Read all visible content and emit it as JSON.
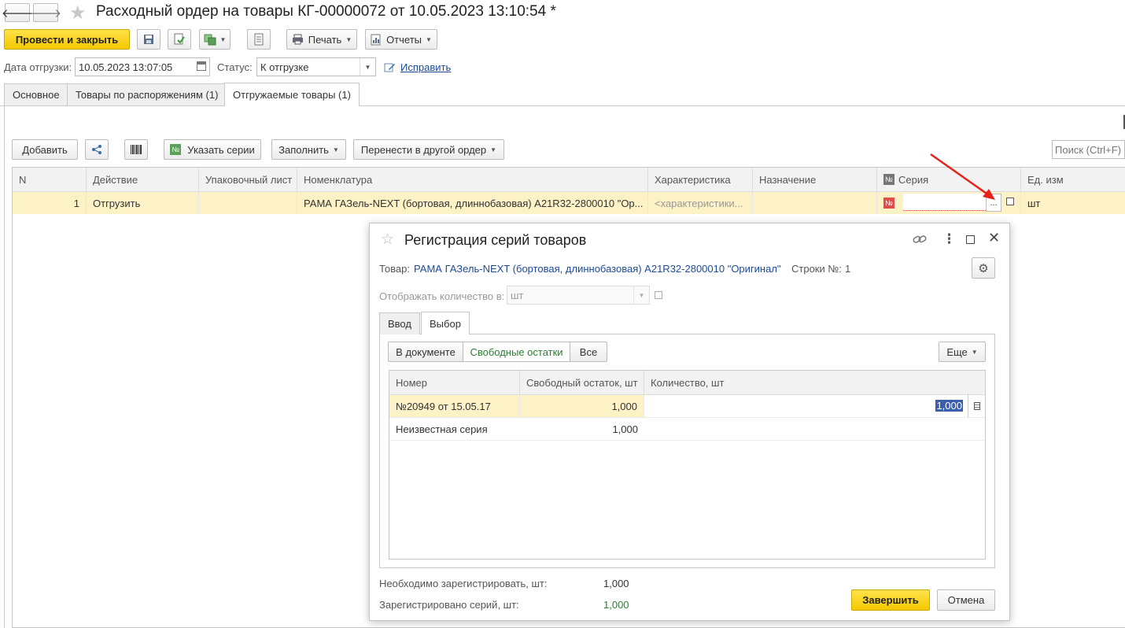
{
  "window": {
    "title": "Расходный ордер на товары КГ-00000072 от 10.05.2023 13:10:54 *"
  },
  "toolbar": {
    "post_close": "Провести и закрыть",
    "print": "Печать",
    "reports": "Отчеты"
  },
  "form": {
    "ship_date_label": "Дата отгрузки:",
    "ship_date_value": "10.05.2023 13:07:05",
    "status_label": "Статус:",
    "status_value": "К отгрузке",
    "fix_link": "Исправить"
  },
  "tabs": [
    {
      "label": "Основное"
    },
    {
      "label": "Товары по распоряжениям (1)"
    },
    {
      "label": "Отгружаемые товары (1)"
    }
  ],
  "table_toolbar": {
    "add": "Добавить",
    "specify_series": "Указать серии",
    "fill": "Заполнить",
    "move_to_order": "Перенести в другой ордер",
    "search_placeholder": "Поиск (Ctrl+F)"
  },
  "table": {
    "columns": [
      "N",
      "Действие",
      "Упаковочный лист",
      "Номенклатура",
      "Характеристика",
      "Назначение",
      "Серия",
      "Ед. изм"
    ],
    "rows": [
      {
        "n": "1",
        "action": "Отгрузить",
        "packing_list": "",
        "nomenclature": "РАМА ГАЗель-NEXT (бортовая, длиннобазовая) А21R32-2800010 \"Ор...",
        "characteristic": "<характеристики...",
        "purpose": "",
        "series": "",
        "series_button": "...",
        "unit": "шт"
      }
    ]
  },
  "dialog": {
    "title": "Регистрация серий товаров",
    "product_label": "Товар:",
    "product_value": "РАМА ГАЗель-NEXT (бортовая, длиннобазовая) А21R32-2800010 \"Оригинал\"",
    "rows_label": "Строки №:",
    "rows_value": "1",
    "show_qty_label": "Отображать количество в:",
    "show_qty_value": "шт",
    "tabs": [
      {
        "label": "Ввод"
      },
      {
        "label": "Выбор"
      }
    ],
    "filter_buttons": [
      {
        "label": "В документе"
      },
      {
        "label": "Свободные остатки"
      },
      {
        "label": "Все"
      }
    ],
    "more_button": "Еще",
    "grid": {
      "columns": [
        "Номер",
        "Свободный остаток, шт",
        "Количество, шт"
      ],
      "rows": [
        {
          "number": "№20949 от 15.05.17",
          "free": "1,000",
          "qty": "1,000"
        },
        {
          "number": "Неизвестная серия",
          "free": "1,000",
          "qty": ""
        }
      ]
    },
    "need_register_label": "Необходимо зарегистрировать, шт:",
    "need_register_value": "1,000",
    "registered_label": "Зарегистрировано серий, шт:",
    "registered_value": "1,000",
    "finish_button": "Завершить",
    "cancel_button": "Отмена"
  },
  "colors": {
    "accent_yellow": "#f4c800",
    "selected_row": "#fdf1c6",
    "link_blue": "#1a4b9a",
    "green_text": "#2e7d32",
    "arrow_red": "#e8211d"
  }
}
